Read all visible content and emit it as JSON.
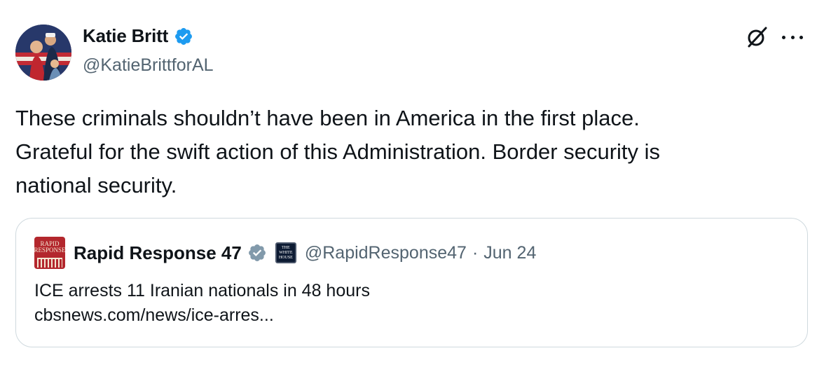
{
  "author": {
    "display_name": "Katie Britt",
    "handle": "@KatieBrittforAL",
    "verified_color": "#1d9bf0",
    "avatar_icon": "profile-photo"
  },
  "actions": {
    "grok_icon": "grok-icon",
    "more_icon": "more-options-icon"
  },
  "tweet": {
    "text": "These criminals shouldn’t have been in America in the first place.\nGrateful for the swift action of this Administration. Border security is\nnational security."
  },
  "quote": {
    "logo_text_line1": "RAPID",
    "logo_text_line2": "RESPONSE",
    "display_name": "Rapid Response 47",
    "verified_color": "#829aab",
    "affiliation_badge_line1": "THE",
    "affiliation_badge_line2": "WHITE",
    "affiliation_badge_line3": "HOUSE",
    "handle": "@RapidResponse47",
    "separator": "·",
    "date": "Jun 24",
    "text_line1": "ICE arrests 11 Iranian nationals in 48 hours",
    "link": "cbsnews.com/news/ice-arres..."
  }
}
